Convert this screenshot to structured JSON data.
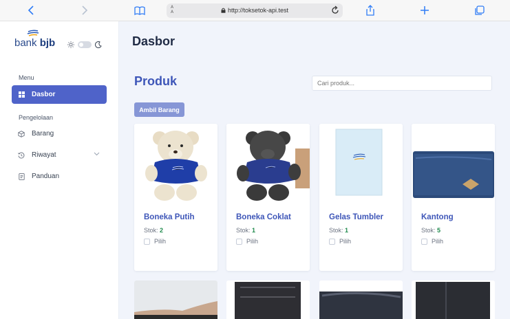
{
  "browser": {
    "url": "http://toksetok-api.test",
    "aa_label": "A A"
  },
  "sidebar": {
    "logo_prefix": "bank ",
    "logo_bold": "bjb",
    "section_menu": "Menu",
    "section_pengelolaan": "Pengelolaan",
    "items": [
      {
        "label": "Dasbor",
        "icon": "grid-icon",
        "active": true
      },
      {
        "label": "Barang",
        "icon": "box-icon"
      },
      {
        "label": "Riwayat",
        "icon": "history-icon"
      },
      {
        "label": "Panduan",
        "icon": "document-icon"
      }
    ]
  },
  "header": {
    "title": "Dasbor"
  },
  "main": {
    "section_title": "Produk",
    "search_placeholder": "Cari produk...",
    "ambil_button": "Ambil Barang",
    "stok_label": "Stok:",
    "pilih_label": "Pilih",
    "products": [
      {
        "name": "Boneka Putih",
        "stok": "2"
      },
      {
        "name": "Boneka Coklat",
        "stok": "1"
      },
      {
        "name": "Gelas Tumbler",
        "stok": "1"
      },
      {
        "name": "Kantong",
        "stok": "5"
      }
    ]
  },
  "colors": {
    "accent": "#4f63c9",
    "title_blue": "#3e56b8",
    "button": "#8696d6",
    "stok_green": "#1f8a4c"
  }
}
